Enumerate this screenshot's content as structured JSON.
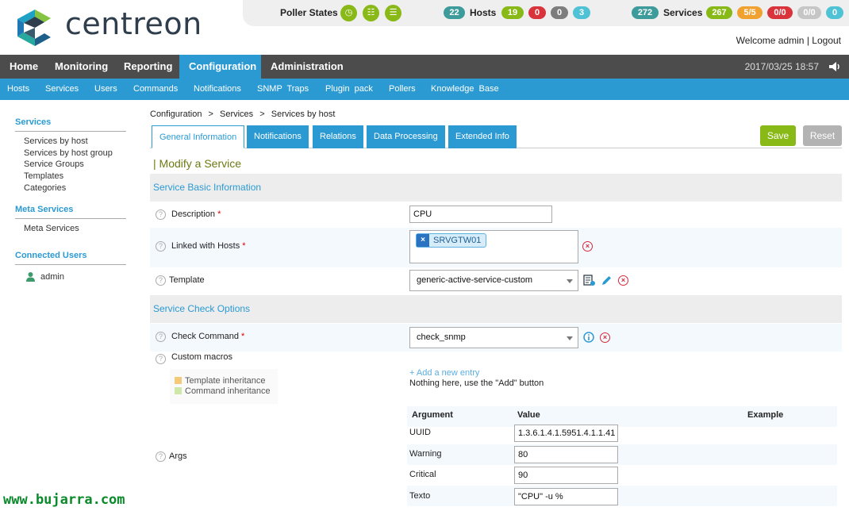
{
  "brand": {
    "name": "centreon"
  },
  "topbar": {
    "poller_states_label": "Poller States",
    "poller_icons": [
      "clock-icon",
      "database-icon",
      "server-stack-icon"
    ],
    "hosts": {
      "total": "22",
      "label": "Hosts",
      "up": "19",
      "down": "0",
      "unreachable": "0",
      "pending": "3"
    },
    "services": {
      "total": "272",
      "label": "Services",
      "ok": "267",
      "warning": "5/5",
      "critical": "0/0",
      "unknown": "0/0",
      "pending": "0"
    },
    "colors": {
      "teal": "#3d9b9b",
      "green": "#88b917",
      "orange": "#f0a130",
      "red": "#d9343b",
      "grey": "#7d7d7d",
      "light_grey": "#c6c6c6",
      "cyan": "#4fc2d6"
    }
  },
  "user": {
    "welcome": "Welcome admin",
    "separator": "|",
    "logout": "Logout"
  },
  "main_nav": {
    "items": [
      "Home",
      "Monitoring",
      "Reporting",
      "Configuration",
      "Administration"
    ],
    "active": "Configuration",
    "datetime": "2017/03/25 18:57"
  },
  "sub_nav": {
    "items": [
      "Hosts",
      "Services",
      "Users",
      "Commands",
      "Notifications",
      "SNMP Traps",
      "Plugin pack",
      "Pollers",
      "Knowledge Base"
    ]
  },
  "sidebar": {
    "services_head": "Services",
    "services_items": [
      "Services by host",
      "Services by host group",
      "Service Groups",
      "Templates",
      "Categories"
    ],
    "meta_head": "Meta Services",
    "meta_items": [
      "Meta Services"
    ],
    "users_head": "Connected Users",
    "users": [
      "admin"
    ]
  },
  "breadcrumb": [
    "Configuration",
    "Services",
    "Services by host"
  ],
  "breadcrumb_sep": ">",
  "tabs": [
    "General Information",
    "Notifications",
    "Relations",
    "Data Processing",
    "Extended Info"
  ],
  "buttons": {
    "save": "Save",
    "reset": "Reset"
  },
  "form": {
    "title": "| Modify a Service",
    "section_basic": "Service Basic Information",
    "description_label": "Description",
    "description_value": "CPU",
    "linked_hosts_label": "Linked with Hosts",
    "linked_host_tag": "SRVGTW01",
    "template_label": "Template",
    "template_value": "generic-active-service-custom",
    "section_check": "Service Check Options",
    "check_command_label": "Check Command",
    "check_command_value": "check_snmp",
    "custom_macros_label": "Custom macros",
    "legend_template": "Template inheritance",
    "legend_command": "Command inheritance",
    "add_entry": "+ Add a new entry",
    "nothing_here": "Nothing here, use the \"Add\" button",
    "args_label": "Args",
    "args_headers": {
      "argument": "Argument",
      "value": "Value",
      "example": "Example"
    },
    "args": [
      {
        "name": "UUID",
        "value": "1.3.6.1.4.1.5951.4.1.1.41"
      },
      {
        "name": "Warning",
        "value": "80"
      },
      {
        "name": "Critical",
        "value": "90"
      },
      {
        "name": "Texto",
        "value": "\"CPU\" -u %"
      }
    ],
    "required_mark": "*",
    "help_glyph": "?"
  },
  "watermark": "www.bujarra.com"
}
